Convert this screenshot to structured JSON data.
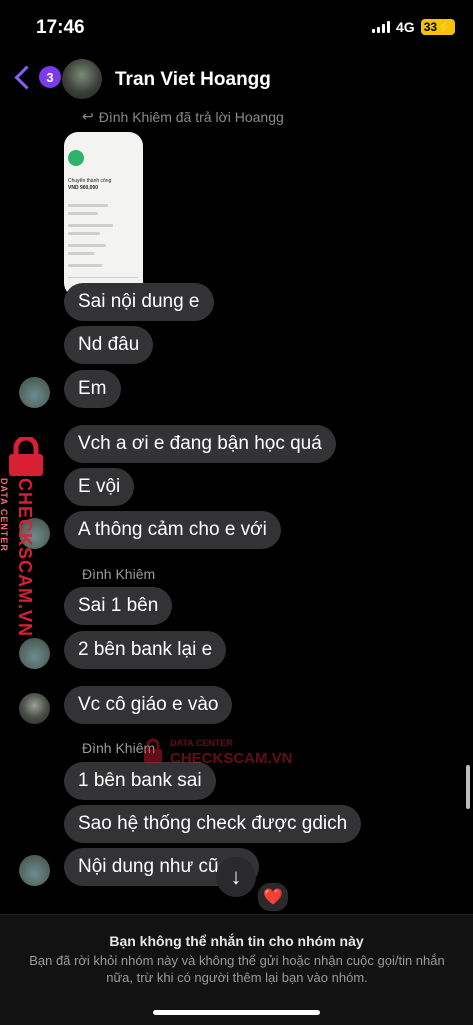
{
  "status": {
    "time": "17:46",
    "network": "4G",
    "battery": "33"
  },
  "header": {
    "back_badge": "3",
    "title": "Tran Viet Hoangg"
  },
  "reply_context": "Đình Khiêm đã trả lời Hoangg",
  "image_preview": {
    "title": "Chuyển thành công",
    "amount": "VND 900,000"
  },
  "messages": [
    "Sai nội dung e",
    "Nd đâu",
    "Em",
    "Vch a ơi e đang bận học quá",
    "E vội",
    "A thông cảm cho e với",
    "Sai 1 bên",
    "2 bên bank lại e",
    "Vc cô giáo e vào",
    "1 bên bank sai",
    "Sao hệ thống check được gdich",
    "Nội dung như cũ  an"
  ],
  "senders": [
    "Đình Khiêm",
    "Đình Khiêm"
  ],
  "watermark": {
    "brand": "CHECKSCAM.VN",
    "sub": "DATA CENTER"
  },
  "reaction": "❤️",
  "footer": {
    "title": "Bạn không thể nhắn tin cho nhóm này",
    "body": "Bạn đã rời khỏi nhóm này và không thể gửi hoặc nhận cuộc gọi/tin nhắn nữa, trừ khi có người thêm lại bạn vào nhóm."
  },
  "colors": {
    "accent": "#7c3aed",
    "bubble": "#333335",
    "watermark": "#d91f34"
  }
}
